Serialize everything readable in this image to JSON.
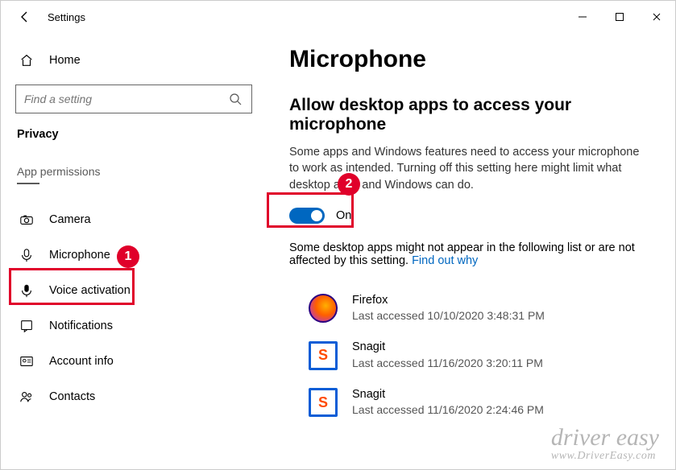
{
  "window": {
    "title": "Settings"
  },
  "sidebar": {
    "home": "Home",
    "search_placeholder": "Find a setting",
    "section": "Privacy",
    "group_label": "App permissions",
    "items": [
      {
        "label": "Camera"
      },
      {
        "label": "Microphone"
      },
      {
        "label": "Voice activation"
      },
      {
        "label": "Notifications"
      },
      {
        "label": "Account info"
      },
      {
        "label": "Contacts"
      }
    ]
  },
  "main": {
    "page_title": "Microphone",
    "section_title": "Allow desktop apps to access your microphone",
    "description": "Some apps and Windows features need to access your microphone to work as intended. Turning off this setting here might limit what desktop apps and Windows can do.",
    "toggle_label": "On",
    "note_prefix": "Some desktop apps might not appear in the following list or are not affected by this setting. ",
    "note_link": "Find out why",
    "apps": [
      {
        "name": "Firefox",
        "sub": "Last accessed 10/10/2020 3:48:31 PM"
      },
      {
        "name": "Snagit",
        "sub": "Last accessed 11/16/2020 3:20:11 PM"
      },
      {
        "name": "Snagit",
        "sub": "Last accessed 11/16/2020 2:24:46 PM"
      }
    ]
  },
  "annotations": {
    "bubble1": "1",
    "bubble2": "2"
  },
  "watermark": {
    "line1": "driver easy",
    "line2": "www.DriverEasy.com"
  }
}
